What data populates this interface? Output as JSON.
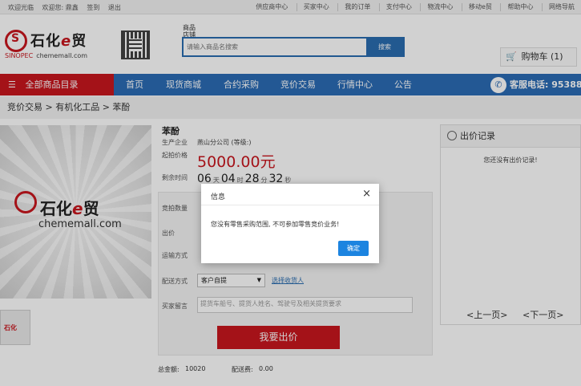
{
  "topbar": {
    "left": [
      "欢迎光临",
      "欢迎您: 鼎鑫",
      "签到",
      "退出"
    ],
    "right": [
      "供应商中心",
      "买家中心",
      "我的订单",
      "支付中心",
      "物流中心",
      "移动e贸",
      "帮助中心",
      "网络导航"
    ]
  },
  "logo": {
    "brand_prefix": "石化",
    "brand_e": "e",
    "brand_suffix": "贸",
    "sub_mark": "SINOPEC",
    "sub_url": "chememall.com"
  },
  "search": {
    "tabs": "商品\n店铺",
    "placeholder": "请输入商品名搜索",
    "button": "搜索"
  },
  "cart": {
    "label": "购物车",
    "count": "(1)"
  },
  "nav": {
    "category": "全部商品目录",
    "items": [
      "首页",
      "现货商城",
      "合约采购",
      "竞价交易",
      "行情中心",
      "公告"
    ],
    "phone": "客服电话: 95388"
  },
  "breadcrumb": "竞价交易 > 有机化工品 > 苯酚",
  "product": {
    "title": "苯酚",
    "producer_label": "生产企业",
    "producer": "燕山分公司 (等级:)",
    "start_price_label": "起拍价格",
    "start_price": "5000.00元",
    "remaining_label": "剩余时间",
    "countdown": {
      "d": "06",
      "d_unit": "天",
      "h": "04",
      "h_unit": "时",
      "m": "28",
      "m_unit": "分",
      "s": "32",
      "s_unit": "秒"
    },
    "image_brand_prefix": "石化",
    "image_brand_e": "e",
    "image_brand_suffix": "贸",
    "image_url": "chememall.com"
  },
  "form": {
    "qty_label": "竞拍数量",
    "bid_label": "出价",
    "transport_label": "运输方式",
    "delivery_label": "配送方式",
    "delivery_value": "客户自提",
    "select_receiver": "选择收货人",
    "message_label": "买家留言",
    "message_placeholder": "提货车船号、提货人姓名、驾驶号及相关提货要求",
    "submit": "我要出价",
    "total_label": "总金额:",
    "total_value": "10020",
    "shipping_label": "配送费:",
    "shipping_value": "0.00"
  },
  "record": {
    "title": "出价记录",
    "empty": "您还没有出价记录!",
    "prev": "<上一页>",
    "next": "<下一页>"
  },
  "modal": {
    "title": "信息",
    "close": "×",
    "message": "您没有零售采购范围, 不可参加零售竞价业务!",
    "ok": "确定"
  },
  "colors": {
    "brand_red": "#c8161e",
    "nav_blue": "#2b6cb5",
    "ok_blue": "#1c84e0"
  }
}
